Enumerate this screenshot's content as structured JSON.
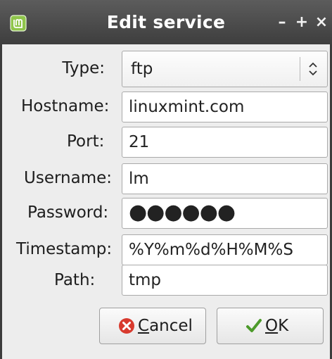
{
  "window": {
    "title": "Edit service"
  },
  "titlebar": {
    "minimize": "–",
    "maximize": "+",
    "close": "×"
  },
  "form": {
    "type_label": "Type:",
    "type_value": "ftp",
    "hostname_label": "Hostname:",
    "hostname_value": "linuxmint.com",
    "port_label": "Port:",
    "port_value": "21",
    "username_label": "Username:",
    "username_value": "lm",
    "password_label": "Password:",
    "password_mask": "●●●●●●",
    "timestamp_label": "Timestamp:",
    "timestamp_value": "%Y%m%d%H%M%S",
    "path_label": "Path:",
    "path_value": "tmp"
  },
  "buttons": {
    "cancel_mnemonic": "C",
    "cancel_rest": "ancel",
    "ok_mnemonic": "O",
    "ok_rest": "K"
  },
  "icons": {
    "app": "linux-mint-icon",
    "combo": "up-down-arrows-icon",
    "cancel": "red-x-circle-icon",
    "ok": "green-checkmark-icon"
  },
  "colors": {
    "titlebar": "#4a4a4a",
    "cancel_icon": "#d83a2e",
    "ok_icon": "#4c9a2a",
    "mint_green": "#8fc54b"
  }
}
